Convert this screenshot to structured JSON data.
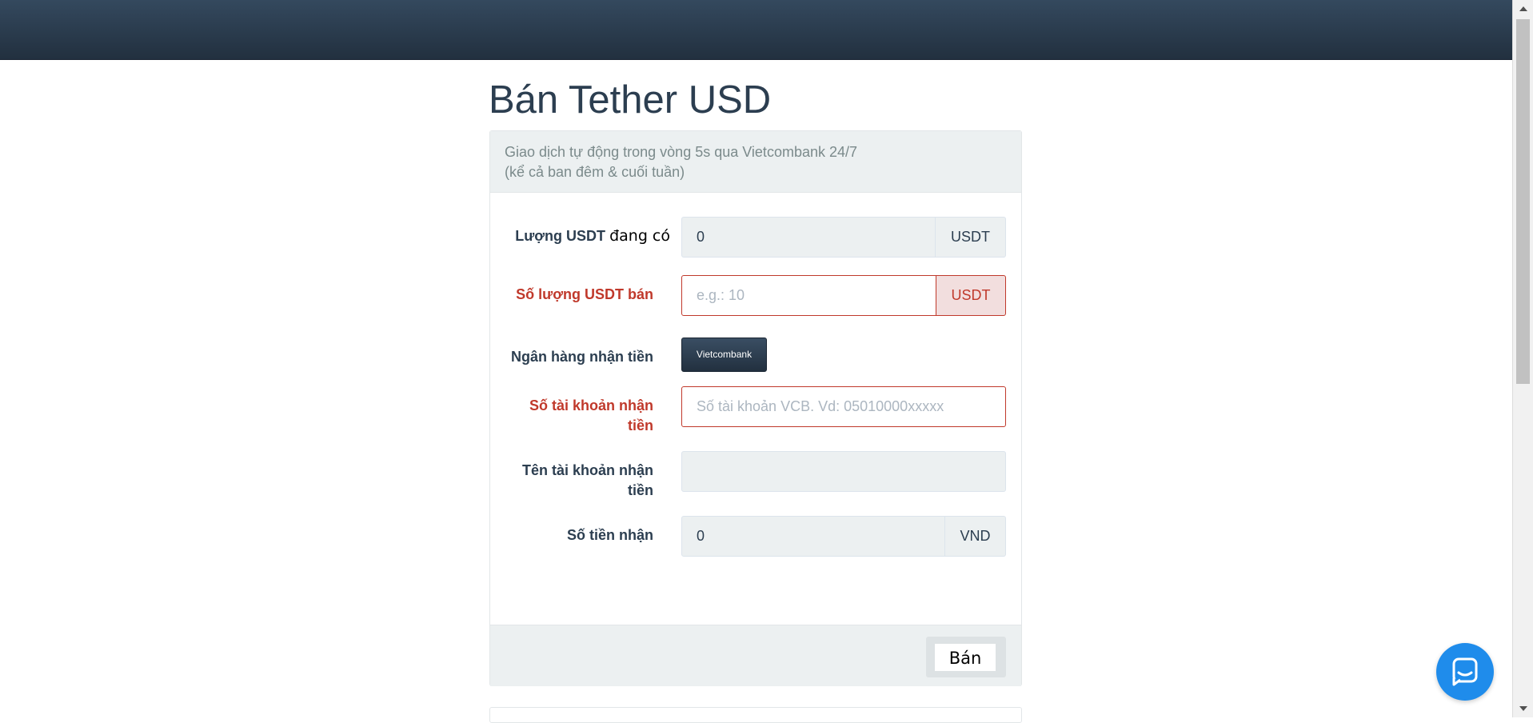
{
  "page": {
    "title": "Bán Tether USD",
    "notice_line1": "Giao dịch tự động trong vòng 5s qua Vietcombank 24/7",
    "notice_line2": "(kể cả ban đêm & cuối tuần)"
  },
  "form": {
    "balance": {
      "label_bold": "Lượng USDT",
      "label_plain": "đang có",
      "value": "0",
      "unit": "USDT"
    },
    "sell_amount": {
      "label": "Số lượng USDT bán",
      "placeholder": "e.g.: 10",
      "unit": "USDT"
    },
    "bank": {
      "label": "Ngân hàng nhận tiền",
      "button": "Vietcombank"
    },
    "account_number": {
      "label_line1": "Số tài khoản nhận",
      "label_line2": "tiền",
      "placeholder": "Số tài khoản VCB. Vd: 05010000xxxxx"
    },
    "account_name": {
      "label_line1": "Tên tài khoản nhận",
      "label_line2": "tiền",
      "value": ""
    },
    "receive_amount": {
      "label": "Số tiền nhận",
      "value": "0",
      "unit": "VND"
    },
    "submit": "Bán"
  },
  "colors": {
    "navbar": "#2c3e50",
    "error": "#c0392b",
    "chat": "#1f8ceb"
  },
  "icons": {
    "chat": "chat-icon"
  }
}
